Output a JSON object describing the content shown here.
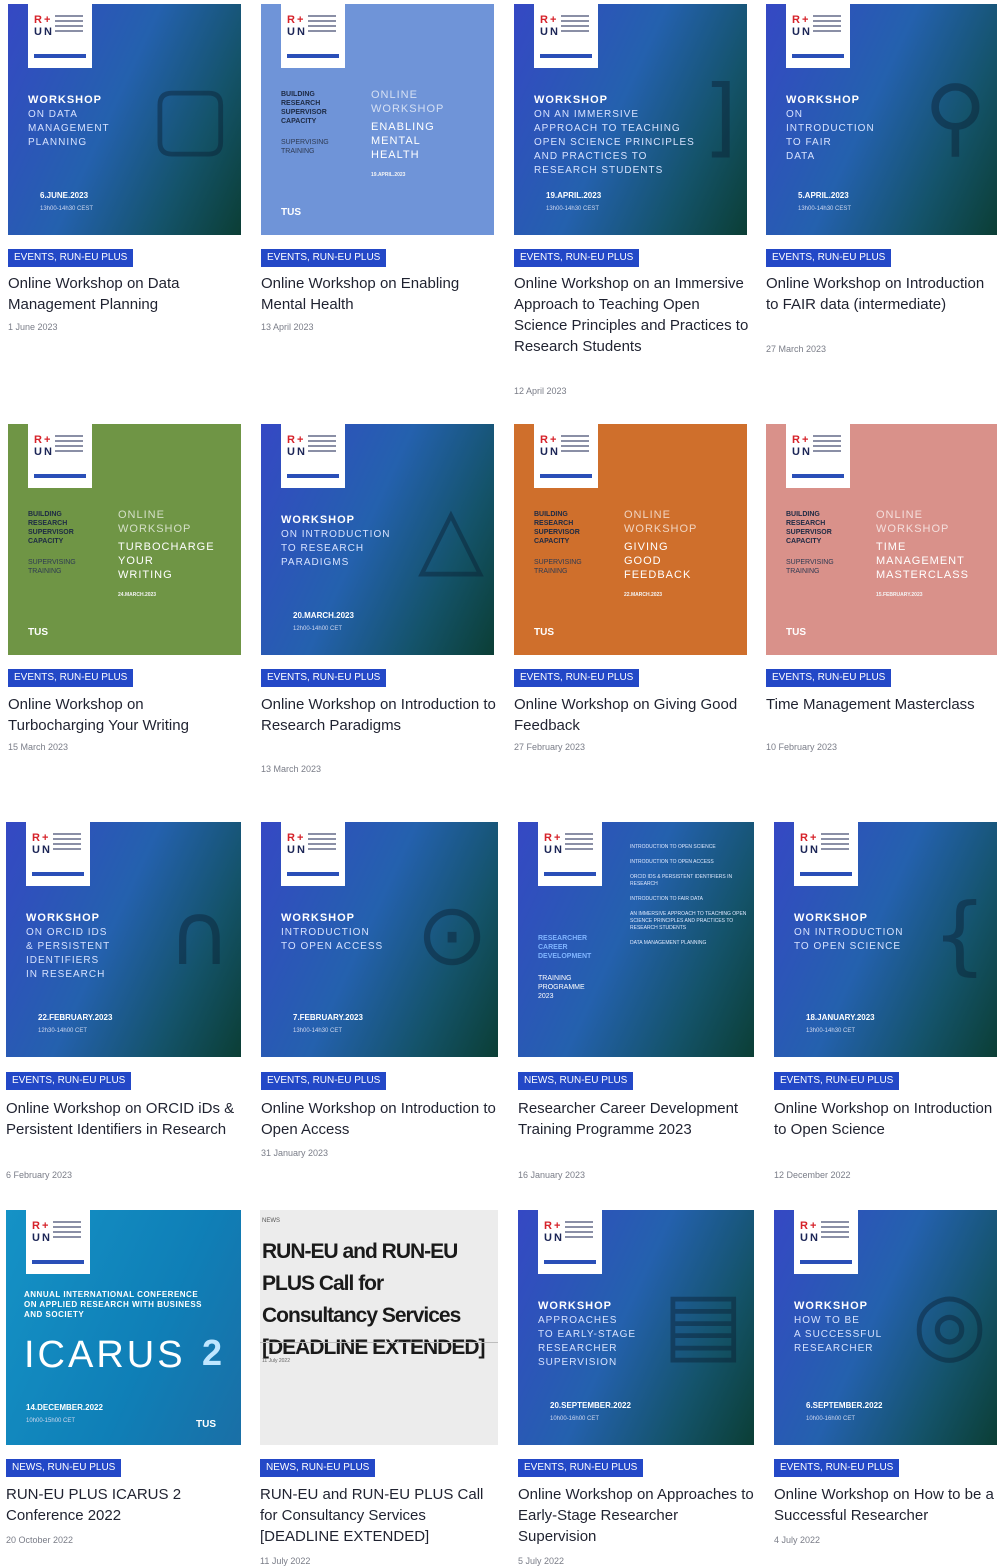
{
  "logo": {
    "mark_top": "R+",
    "mark_bottom": "UN"
  },
  "cards": [
    {
      "thumb": {
        "style": "blue",
        "head": "WORKSHOP",
        "sub": "ON DATA\nMANAGEMENT\nPLANNING",
        "date": "6.JUNE.2023",
        "time": "13h00-14h30 CEST",
        "icon": "calendar-icon",
        "glyph": "▢"
      },
      "badge": "EVENTS, RUN-EU PLUS",
      "title": "Online Workshop on Data Management Planning",
      "date": "1 June 2023"
    },
    {
      "thumb": {
        "style": "lblue",
        "left": "BUILDING\nRESEARCH\nSUPERVISOR\nCAPACITY",
        "left2": "SUPERVISING\nTRAINING",
        "online": "ONLINE\nWORKSHOP",
        "topic": "ENABLING\nMENTAL\nHEALTH",
        "sdate": "19.APRIL.2023",
        "tus": "TUS"
      },
      "badge": "EVENTS, RUN-EU PLUS",
      "title": "Online Workshop on Enabling Mental Health",
      "date": "13 April 2023"
    },
    {
      "thumb": {
        "style": "blue",
        "head": "WORKSHOP",
        "sub": "ON AN IMMERSIVE\nAPPROACH TO TEACHING\nOPEN SCIENCE PRINCIPLES\nAND PRACTICES TO\nRESEARCH STUDENTS",
        "date": "19.APRIL.2023",
        "time": "13h00-14h30 CEST",
        "icon": "bracket-icon",
        "glyph": "]"
      },
      "badge": "EVENTS, RUN-EU PLUS",
      "title": "Online Workshop on an Immersive Approach to Teaching Open Science Principles and Practices to Research Students",
      "date": "12 April 2023"
    },
    {
      "thumb": {
        "style": "blue",
        "head": "WORKSHOP",
        "sub": "ON\nINTRODUCTION\nTO FAIR\nDATA",
        "date": "5.APRIL.2023",
        "time": "13h00-14h30 CEST",
        "icon": "magnifier-icon",
        "glyph": "⚲"
      },
      "badge": "EVENTS, RUN-EU PLUS",
      "title": "Online Workshop on Introduction to FAIR data (intermediate)",
      "date": "27 March 2023"
    },
    {
      "thumb": {
        "style": "green",
        "left": "BUILDING\nRESEARCH\nSUPERVISOR\nCAPACITY",
        "left2": "SUPERVISING\nTRAINING",
        "online": "ONLINE\nWORKSHOP",
        "topic": "TURBOCHARGE\nYOUR\nWRITING",
        "sdate": "24.MARCH.2023",
        "tus": "TUS"
      },
      "badge": "EVENTS, RUN-EU PLUS",
      "title": "Online Workshop on Turbocharging Your Writing",
      "date": "15 March 2023"
    },
    {
      "thumb": {
        "style": "blue",
        "head": "WORKSHOP",
        "sub": "ON INTRODUCTION\nTO RESEARCH\nPARADIGMS",
        "date": "20.MARCH.2023",
        "time": "12h00-14h00 CET",
        "icon": "triangle-icon",
        "glyph": "△"
      },
      "badge": "EVENTS, RUN-EU PLUS",
      "title": "Online Workshop on Introduction to Research Paradigms",
      "date": "13 March 2023"
    },
    {
      "thumb": {
        "style": "orange",
        "left": "BUILDING\nRESEARCH\nSUPERVISOR\nCAPACITY",
        "left2": "SUPERVISING\nTRAINING",
        "online": "ONLINE\nWORKSHOP",
        "topic": "GIVING\nGOOD\nFEEDBACK",
        "sdate": "22.MARCH.2023",
        "tus": "TUS"
      },
      "badge": "EVENTS, RUN-EU PLUS",
      "title": "Online Workshop on Giving Good Feedback",
      "date": "27 February 2023"
    },
    {
      "thumb": {
        "style": "rose",
        "left": "BUILDING\nRESEARCH\nSUPERVISOR\nCAPACITY",
        "left2": "SUPERVISING\nTRAINING",
        "online": "ONLINE\nWORKSHOP",
        "topic": "TIME\nMANAGEMENT\nMASTERCLASS",
        "sdate": "15.FEBRUARY.2023",
        "tus": "TUS"
      },
      "badge": "EVENTS, RUN-EU PLUS",
      "title": "Time Management Masterclass",
      "date": "10 February 2023"
    },
    {
      "thumb": {
        "style": "blue",
        "head": "WORKSHOP",
        "sub": "ON ORCID iDs\n& PERSISTENT\nIDENTIFIERS\nIN RESEARCH",
        "date": "22.FEBRUARY.2023",
        "time": "12h30-14h00 CET",
        "icon": "orcid-icon",
        "glyph": "∩"
      },
      "badge": "EVENTS, RUN-EU PLUS",
      "title": "Online Workshop on ORCID iDs & Persistent Identifiers in Research",
      "date": "6 February 2023"
    },
    {
      "thumb": {
        "style": "blue",
        "head": "WORKSHOP",
        "sub": "INTRODUCTION\nTO OPEN ACCESS",
        "date": "7.FEBRUARY.2023",
        "time": "13h00-14h30 CET",
        "icon": "open-lock-icon",
        "glyph": "⊙"
      },
      "badge": "EVENTS, RUN-EU PLUS",
      "title": "Online Workshop on Introduction to Open Access",
      "date": "31 January 2023"
    },
    {
      "thumb": {
        "style": "blue",
        "program": true,
        "prog_left": "RESEARCHER\nCAREER\nDEVELOPMENT",
        "prog_left2": "TRAINING\nPROGRAMME\n2023",
        "items": [
          "Introduction to Open Science",
          "Introduction to Open Access",
          "ORCID iDs & Persistent Identifiers in Research",
          "Introduction to FAIR Data",
          "An Immersive Approach to Teaching Open Science Principles and Practices to Research Students",
          "Data Management Planning"
        ]
      },
      "badge": "NEWS, RUN-EU PLUS",
      "title": "Researcher Career Development Training Programme 2023",
      "date": "16 January 2023"
    },
    {
      "thumb": {
        "style": "blue",
        "head": "WORKSHOP",
        "sub": "ON INTRODUCTION\nTO OPEN SCIENCE",
        "date": "18.JANUARY.2023",
        "time": "13h00-14h30 CET",
        "icon": "brace-icon",
        "glyph": "{"
      },
      "badge": "EVENTS, RUN-EU PLUS",
      "title": "Online Workshop on Introduction to Open Science",
      "date": "12 December 2022"
    },
    {
      "thumb": {
        "style": "cyan",
        "icarus": true,
        "head": "ANNUAL INTERNATIONAL CONFERENCE\nON APPLIED RESEARCH WITH BUSINESS\nAND SOCIETY",
        "word": "ICARUS",
        "num": "2",
        "date": "14.DECEMBER.2022",
        "time": "10h00-15h00 CET",
        "tus": "TUS"
      },
      "badge": "NEWS, RUN-EU PLUS",
      "title": "RUN-EU PLUS ICARUS 2 Conference 2022",
      "date": "20 October 2022"
    },
    {
      "thumb": {
        "style": "doc",
        "doc": true,
        "news": "NEWS",
        "doc_title": "RUN-EU and RUN-EU PLUS Call for Consultancy Services [DEADLINE EXTENDED]",
        "doc_date": "11 July 2022"
      },
      "badge": "NEWS, RUN-EU PLUS",
      "title": "RUN-EU and RUN-EU PLUS Call for Consultancy Services [DEADLINE EXTENDED]",
      "date": "11 July 2022"
    },
    {
      "thumb": {
        "style": "blue",
        "head": "WORKSHOP",
        "sub": "APPROACHES\nTO EARLY-STAGE\nRESEARCHER\nSUPERVISION",
        "date": "20.SEPTEMBER.2022",
        "time": "10h00-16h00 CET",
        "icon": "document-icon",
        "glyph": "▤"
      },
      "badge": "EVENTS, RUN-EU PLUS",
      "title": "Online Workshop on Approaches to Early-Stage Researcher Supervision",
      "date": "5 July 2022"
    },
    {
      "thumb": {
        "style": "blue",
        "head": "WORKSHOP",
        "sub": "HOW TO BE\nA SUCCESSFUL\nRESEARCHER",
        "date": "6.SEPTEMBER.2022",
        "time": "10h00-16h00 CET",
        "icon": "target-icon",
        "glyph": "◎"
      },
      "badge": "EVENTS, RUN-EU PLUS",
      "title": "Online Workshop on How to be a Successful Researcher",
      "date": "4 July 2022"
    }
  ]
}
